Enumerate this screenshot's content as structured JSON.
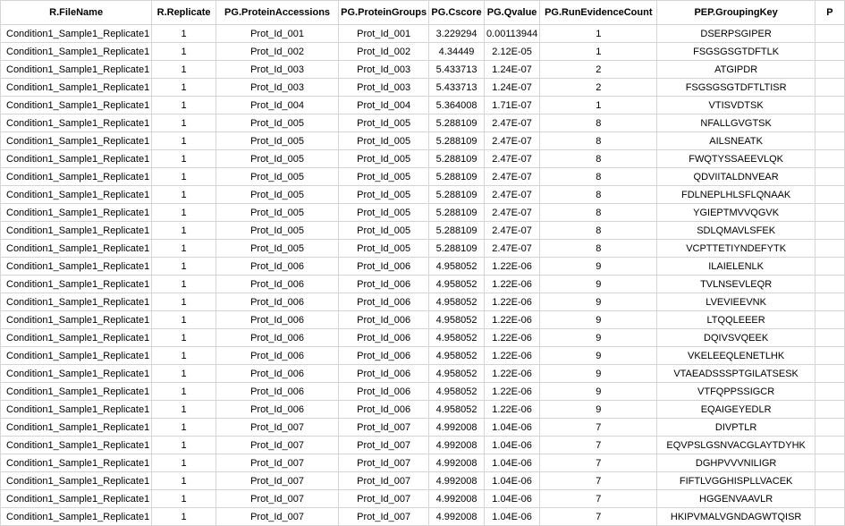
{
  "spreadsheet": {
    "headers": [
      "R.FileName",
      "R.Replicate",
      "PG.ProteinAccessions",
      "PG.ProteinGroups",
      "PG.Cscore",
      "PG.Qvalue",
      "PG.RunEvidenceCount",
      "PEP.GroupingKey",
      "P"
    ],
    "rows": [
      [
        "Condition1_Sample1_Replicate1",
        "1",
        "Prot_Id_001",
        "Prot_Id_001",
        "3.229294",
        "0.00113944",
        "1",
        "DSERPSGIPER",
        ""
      ],
      [
        "Condition1_Sample1_Replicate1",
        "1",
        "Prot_Id_002",
        "Prot_Id_002",
        "4.34449",
        "2.12E-05",
        "1",
        "FSGSGSGTDFTLK",
        ""
      ],
      [
        "Condition1_Sample1_Replicate1",
        "1",
        "Prot_Id_003",
        "Prot_Id_003",
        "5.433713",
        "1.24E-07",
        "2",
        "ATGIPDR",
        ""
      ],
      [
        "Condition1_Sample1_Replicate1",
        "1",
        "Prot_Id_003",
        "Prot_Id_003",
        "5.433713",
        "1.24E-07",
        "2",
        "FSGSGSGTDFTLTISR",
        ""
      ],
      [
        "Condition1_Sample1_Replicate1",
        "1",
        "Prot_Id_004",
        "Prot_Id_004",
        "5.364008",
        "1.71E-07",
        "1",
        "VTISVDTSK",
        ""
      ],
      [
        "Condition1_Sample1_Replicate1",
        "1",
        "Prot_Id_005",
        "Prot_Id_005",
        "5.288109",
        "2.47E-07",
        "8",
        "NFALLGVGTSK",
        ""
      ],
      [
        "Condition1_Sample1_Replicate1",
        "1",
        "Prot_Id_005",
        "Prot_Id_005",
        "5.288109",
        "2.47E-07",
        "8",
        "AILSNEATK",
        ""
      ],
      [
        "Condition1_Sample1_Replicate1",
        "1",
        "Prot_Id_005",
        "Prot_Id_005",
        "5.288109",
        "2.47E-07",
        "8",
        "FWQTYSSAEEVLQK",
        ""
      ],
      [
        "Condition1_Sample1_Replicate1",
        "1",
        "Prot_Id_005",
        "Prot_Id_005",
        "5.288109",
        "2.47E-07",
        "8",
        "QDVIITALDNVEAR",
        ""
      ],
      [
        "Condition1_Sample1_Replicate1",
        "1",
        "Prot_Id_005",
        "Prot_Id_005",
        "5.288109",
        "2.47E-07",
        "8",
        "FDLNEPLHLSFLQNAAK",
        ""
      ],
      [
        "Condition1_Sample1_Replicate1",
        "1",
        "Prot_Id_005",
        "Prot_Id_005",
        "5.288109",
        "2.47E-07",
        "8",
        "YGIEPTMVVQGVK",
        ""
      ],
      [
        "Condition1_Sample1_Replicate1",
        "1",
        "Prot_Id_005",
        "Prot_Id_005",
        "5.288109",
        "2.47E-07",
        "8",
        "SDLQMAVLSFEK",
        ""
      ],
      [
        "Condition1_Sample1_Replicate1",
        "1",
        "Prot_Id_005",
        "Prot_Id_005",
        "5.288109",
        "2.47E-07",
        "8",
        "VCPTTETIYNDEFYTK",
        ""
      ],
      [
        "Condition1_Sample1_Replicate1",
        "1",
        "Prot_Id_006",
        "Prot_Id_006",
        "4.958052",
        "1.22E-06",
        "9",
        "ILAIELENLK",
        ""
      ],
      [
        "Condition1_Sample1_Replicate1",
        "1",
        "Prot_Id_006",
        "Prot_Id_006",
        "4.958052",
        "1.22E-06",
        "9",
        "TVLNSEVLEQR",
        ""
      ],
      [
        "Condition1_Sample1_Replicate1",
        "1",
        "Prot_Id_006",
        "Prot_Id_006",
        "4.958052",
        "1.22E-06",
        "9",
        "LVEVIEEVNK",
        ""
      ],
      [
        "Condition1_Sample1_Replicate1",
        "1",
        "Prot_Id_006",
        "Prot_Id_006",
        "4.958052",
        "1.22E-06",
        "9",
        "LTQQLEEER",
        ""
      ],
      [
        "Condition1_Sample1_Replicate1",
        "1",
        "Prot_Id_006",
        "Prot_Id_006",
        "4.958052",
        "1.22E-06",
        "9",
        "DQIVSVQEEK",
        ""
      ],
      [
        "Condition1_Sample1_Replicate1",
        "1",
        "Prot_Id_006",
        "Prot_Id_006",
        "4.958052",
        "1.22E-06",
        "9",
        "VKELEEQLENETLHK",
        ""
      ],
      [
        "Condition1_Sample1_Replicate1",
        "1",
        "Prot_Id_006",
        "Prot_Id_006",
        "4.958052",
        "1.22E-06",
        "9",
        "VTAEADSSSPTGILATSESK",
        ""
      ],
      [
        "Condition1_Sample1_Replicate1",
        "1",
        "Prot_Id_006",
        "Prot_Id_006",
        "4.958052",
        "1.22E-06",
        "9",
        "VTFQPPSSIGCR",
        ""
      ],
      [
        "Condition1_Sample1_Replicate1",
        "1",
        "Prot_Id_006",
        "Prot_Id_006",
        "4.958052",
        "1.22E-06",
        "9",
        "EQAIGEYEDLR",
        ""
      ],
      [
        "Condition1_Sample1_Replicate1",
        "1",
        "Prot_Id_007",
        "Prot_Id_007",
        "4.992008",
        "1.04E-06",
        "7",
        "DIVPTLR",
        ""
      ],
      [
        "Condition1_Sample1_Replicate1",
        "1",
        "Prot_Id_007",
        "Prot_Id_007",
        "4.992008",
        "1.04E-06",
        "7",
        "EQVPSLGSNVACGLAYTDYHK",
        ""
      ],
      [
        "Condition1_Sample1_Replicate1",
        "1",
        "Prot_Id_007",
        "Prot_Id_007",
        "4.992008",
        "1.04E-06",
        "7",
        "DGHPVVVNILIGR",
        ""
      ],
      [
        "Condition1_Sample1_Replicate1",
        "1",
        "Prot_Id_007",
        "Prot_Id_007",
        "4.992008",
        "1.04E-06",
        "7",
        "FIFTLVGGHISPLLVACEK",
        ""
      ],
      [
        "Condition1_Sample1_Replicate1",
        "1",
        "Prot_Id_007",
        "Prot_Id_007",
        "4.992008",
        "1.04E-06",
        "7",
        "HGGENVAAVLR",
        ""
      ],
      [
        "Condition1_Sample1_Replicate1",
        "1",
        "Prot_Id_007",
        "Prot_Id_007",
        "4.992008",
        "1.04E-06",
        "7",
        "HKIPVMALVGNDAGWTQISR",
        ""
      ]
    ]
  }
}
